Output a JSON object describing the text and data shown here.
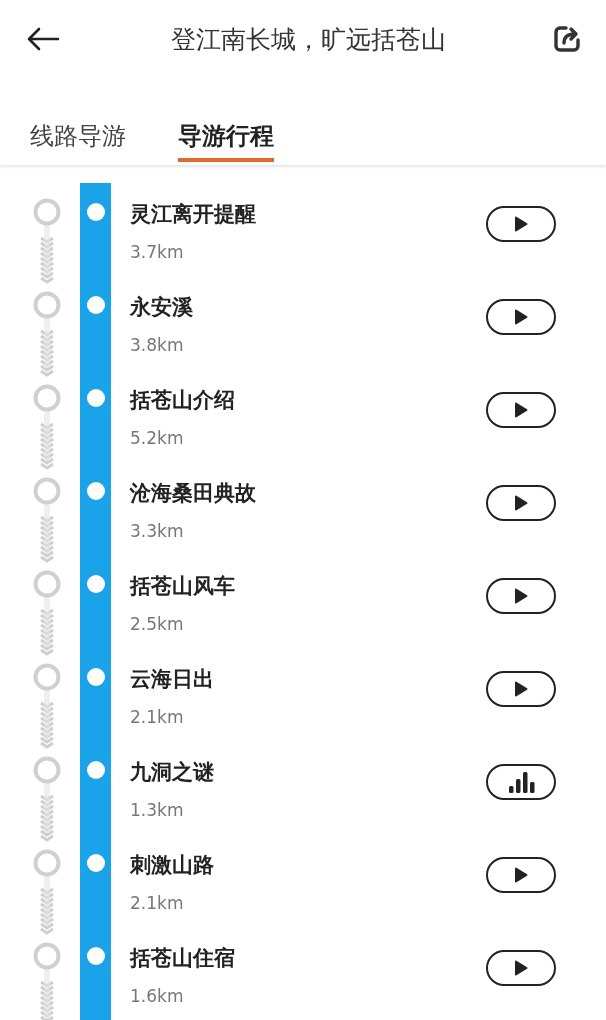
{
  "header": {
    "title": "登江南长城，旷远括苍山"
  },
  "tabs": [
    {
      "label": "线路导游",
      "selected": false
    },
    {
      "label": "导游行程",
      "selected": true
    }
  ],
  "stops": [
    {
      "name": "灵江离开提醒",
      "distance": "3.7km",
      "playing": false
    },
    {
      "name": "永安溪",
      "distance": "3.8km",
      "playing": false
    },
    {
      "name": "括苍山介绍",
      "distance": "5.2km",
      "playing": false
    },
    {
      "name": "沧海桑田典故",
      "distance": "3.3km",
      "playing": false
    },
    {
      "name": "括苍山风车",
      "distance": "2.5km",
      "playing": false
    },
    {
      "name": "云海日出",
      "distance": "2.1km",
      "playing": false
    },
    {
      "name": "九洞之谜",
      "distance": "1.3km",
      "playing": true
    },
    {
      "name": "刺激山路",
      "distance": "2.1km",
      "playing": false
    },
    {
      "name": "括苍山住宿",
      "distance": "1.6km",
      "playing": false
    }
  ]
}
